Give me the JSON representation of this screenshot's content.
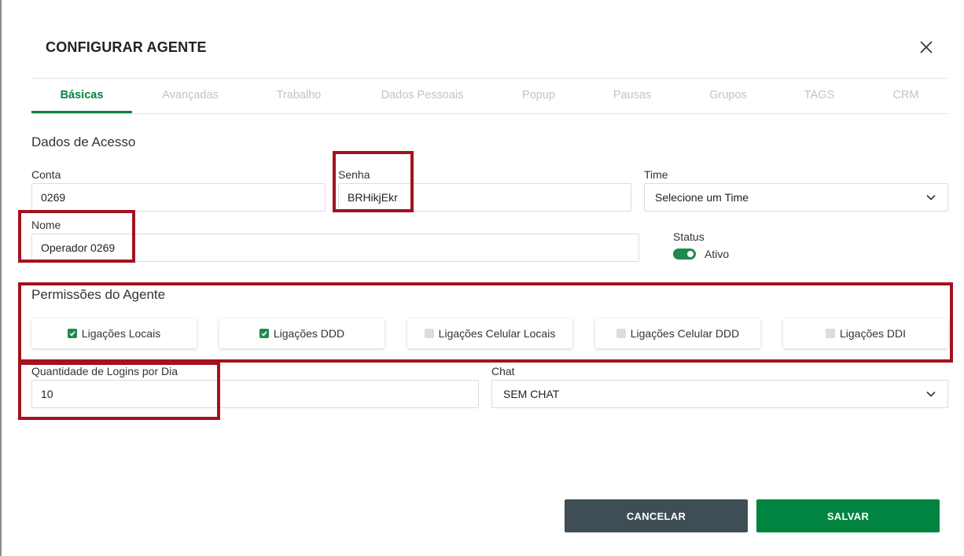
{
  "dialog": {
    "title": "CONFIGURAR AGENTE"
  },
  "tabs": [
    {
      "label": "Básicas",
      "active": true
    },
    {
      "label": "Avançadas",
      "active": false
    },
    {
      "label": "Trabalho",
      "active": false
    },
    {
      "label": "Dados Pessoais",
      "active": false
    },
    {
      "label": "Popup",
      "active": false
    },
    {
      "label": "Pausas",
      "active": false
    },
    {
      "label": "Grupos",
      "active": false
    },
    {
      "label": "TAGS",
      "active": false
    },
    {
      "label": "CRM",
      "active": false
    }
  ],
  "access": {
    "section_title": "Dados de Acesso",
    "conta": {
      "label": "Conta",
      "value": "0269"
    },
    "senha": {
      "label": "Senha",
      "value": "BRHikjEkr"
    },
    "time": {
      "label": "Time",
      "value": "Selecione um Time"
    },
    "nome": {
      "label": "Nome",
      "value": "Operador 0269"
    },
    "status": {
      "label": "Status",
      "value": "Ativo",
      "on": true
    }
  },
  "permissions": {
    "section_title": "Permissões do Agente",
    "items": [
      {
        "label": "Ligações Locais",
        "checked": true
      },
      {
        "label": "Ligações DDD",
        "checked": true
      },
      {
        "label": "Ligações Celular Locais",
        "checked": false
      },
      {
        "label": "Ligações Celular DDD",
        "checked": false
      },
      {
        "label": "Ligações DDI",
        "checked": false
      }
    ]
  },
  "logins": {
    "label": "Quantidade de Logins por Dia",
    "value": "10"
  },
  "chat": {
    "label": "Chat",
    "value": "SEM CHAT"
  },
  "actions": {
    "cancel_label": "CANCELAR",
    "save_label": "SALVAR"
  },
  "colors": {
    "accent": "#00843f",
    "highlight": "#a3121f",
    "cancel": "#3f4d55",
    "inactive_tab": "#c3c3c3"
  }
}
